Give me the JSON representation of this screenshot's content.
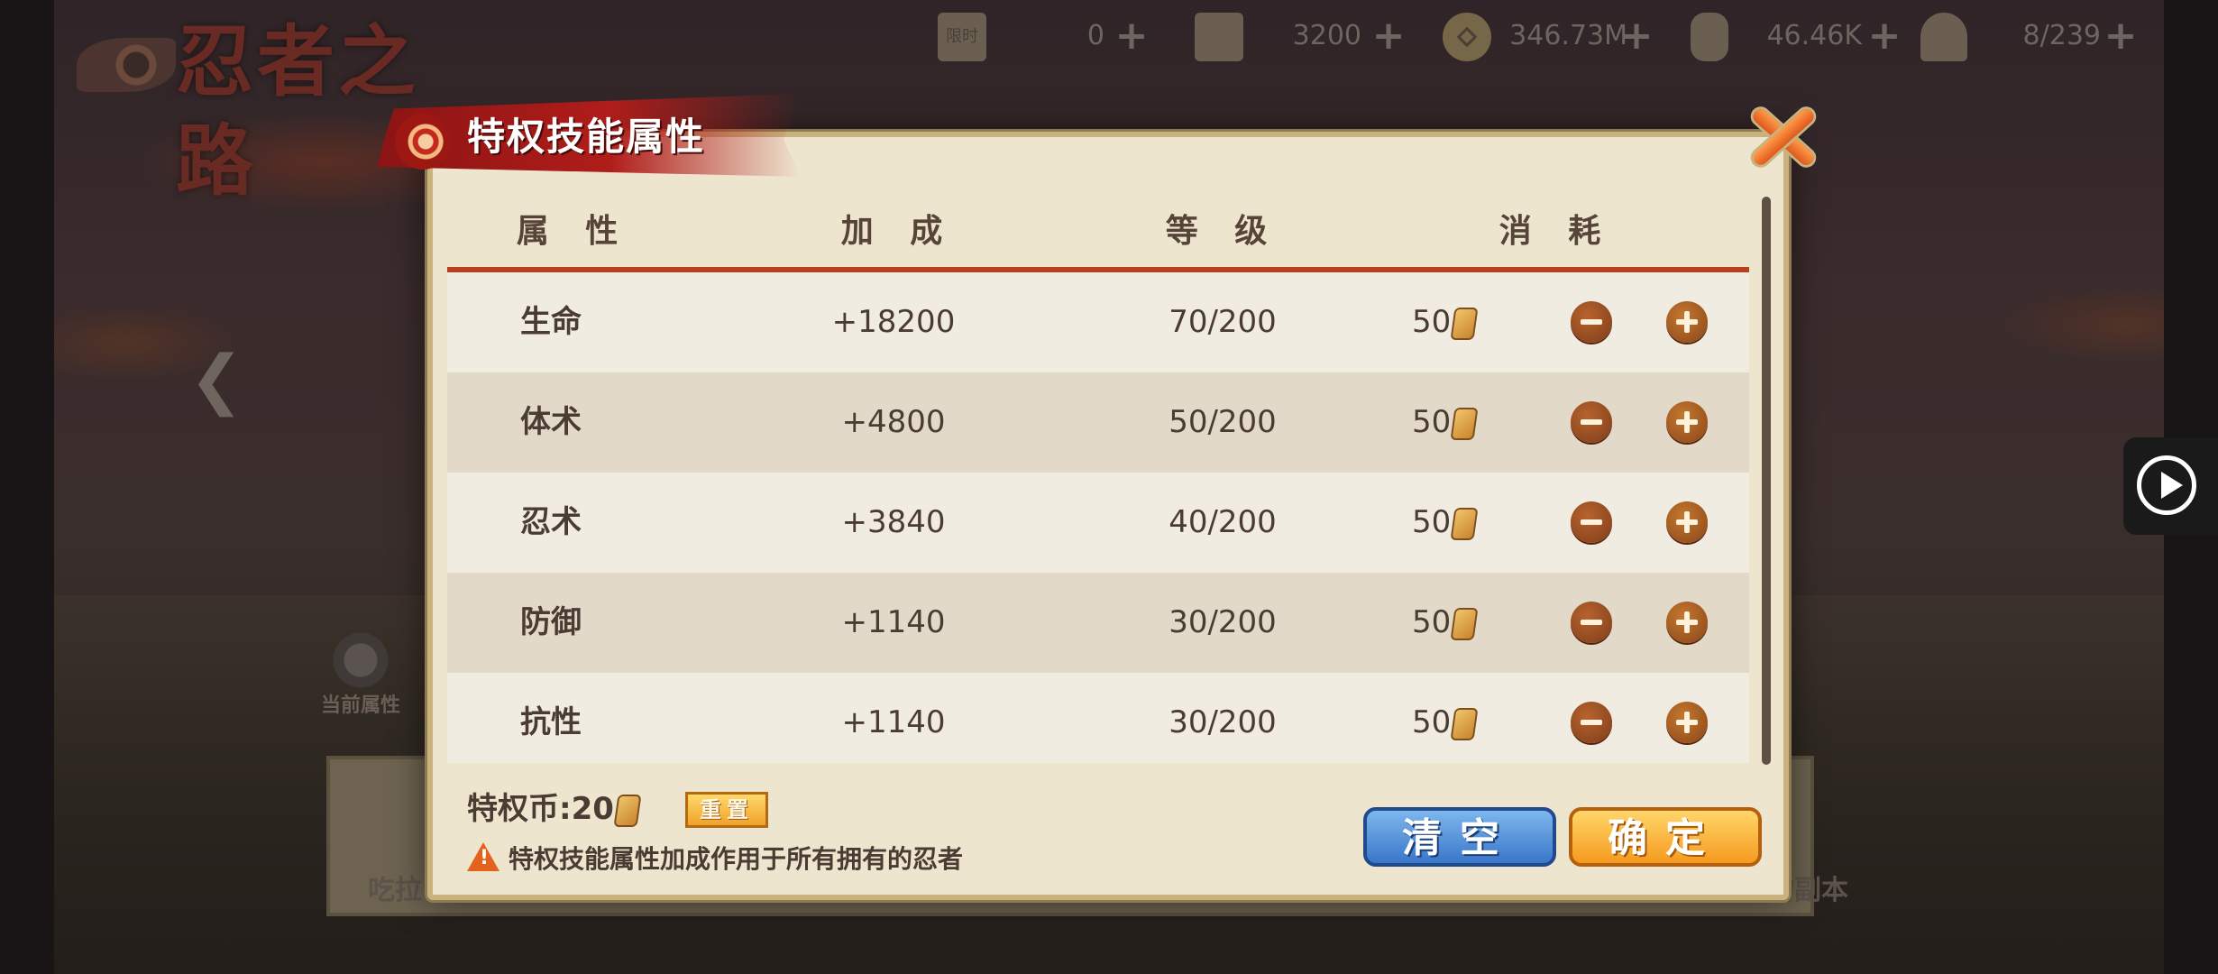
{
  "background": {
    "logo_text": "忍者之路",
    "current_attr_label": "当前属性",
    "card_left_text": "吃拉",
    "card_right_text": "物副本"
  },
  "resources": [
    {
      "icon": "scroll-icon",
      "value": "0"
    },
    {
      "icon": "scroll-icon",
      "value": "3200"
    },
    {
      "icon": "coin-icon",
      "value": "346.73M"
    },
    {
      "icon": "scroll-roll-icon",
      "value": "46.46K"
    },
    {
      "icon": "rice-ball-icon",
      "value": "8/239"
    }
  ],
  "dialog": {
    "title": "特权技能属性",
    "headers": {
      "attribute": "属 性",
      "bonus": "加 成",
      "level": "等 级",
      "cost": "消 耗"
    },
    "rows": [
      {
        "name": "生命",
        "bonus": "+18200",
        "level": "70/200",
        "cost": "50"
      },
      {
        "name": "体术",
        "bonus": "+4800",
        "level": "50/200",
        "cost": "50"
      },
      {
        "name": "忍术",
        "bonus": "+3840",
        "level": "40/200",
        "cost": "50"
      },
      {
        "name": "防御",
        "bonus": "+1140",
        "level": "30/200",
        "cost": "50"
      },
      {
        "name": "抗性",
        "bonus": "+1140",
        "level": "30/200",
        "cost": "50"
      }
    ],
    "privilege_coin": "特权币:20",
    "reset_label": "重置",
    "notice": "特权技能属性加成作用于所有拥有的忍者",
    "clear_label": "清空",
    "confirm_label": "确定"
  },
  "colors": {
    "header_divider": "#b7401e",
    "clear_button": "#3a76c9",
    "confirm_button": "#f59a1e",
    "title_banner": "#b01d1a"
  }
}
